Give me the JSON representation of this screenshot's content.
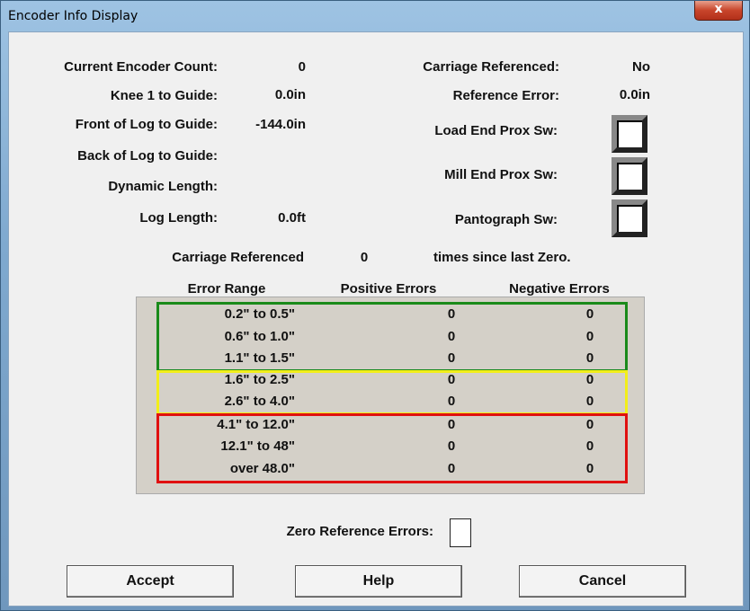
{
  "window": {
    "title": "Encoder Info Display",
    "close_label": "x"
  },
  "left": {
    "current_encoder_count": {
      "label": "Current Encoder Count:",
      "value": "0"
    },
    "knee1": {
      "label": "Knee 1 to Guide:",
      "value": "0.0in"
    },
    "front_log": {
      "label": "Front of Log to Guide:",
      "value": "-144.0in"
    },
    "back_log": {
      "label": "Back of Log to Guide:",
      "value": ""
    },
    "dynamic_length": {
      "label": "Dynamic Length:",
      "value": ""
    },
    "log_length": {
      "label": "Log Length:",
      "value": "0.0ft"
    }
  },
  "right": {
    "carriage_referenced": {
      "label": "Carriage Referenced:",
      "value": "No"
    },
    "reference_error": {
      "label": "Reference Error:",
      "value": "0.0in"
    },
    "load_end": {
      "label": "Load End Prox Sw:"
    },
    "mill_end": {
      "label": "Mill End Prox Sw:"
    },
    "pantograph": {
      "label": "Pantograph Sw:"
    }
  },
  "referenced_line": {
    "prefix": "Carriage Referenced",
    "count": "0",
    "suffix": "times since last Zero."
  },
  "error_table": {
    "headers": [
      "Error Range",
      "Positive Errors",
      "Negative Errors"
    ],
    "rows": [
      {
        "range": "0.2\" to 0.5\"",
        "pos": "0",
        "neg": "0"
      },
      {
        "range": "0.6\" to 1.0\"",
        "pos": "0",
        "neg": "0"
      },
      {
        "range": "1.1\" to 1.5\"",
        "pos": "0",
        "neg": "0"
      },
      {
        "range": "1.6\" to 2.5\"",
        "pos": "0",
        "neg": "0"
      },
      {
        "range": "2.6\" to 4.0\"",
        "pos": "0",
        "neg": "0"
      },
      {
        "range": "4.1\" to 12.0\"",
        "pos": "0",
        "neg": "0"
      },
      {
        "range": "12.1\" to 48\"",
        "pos": "0",
        "neg": "0"
      },
      {
        "range": "over 48.0\"",
        "pos": "0",
        "neg": "0"
      }
    ],
    "group_colors": {
      "green": "#1a8a1a",
      "yellow": "#f2ee1a",
      "red": "#e01010"
    }
  },
  "zero_reference": {
    "label": "Zero Reference Errors:"
  },
  "buttons": {
    "accept": "Accept",
    "help": "Help",
    "cancel": "Cancel"
  }
}
